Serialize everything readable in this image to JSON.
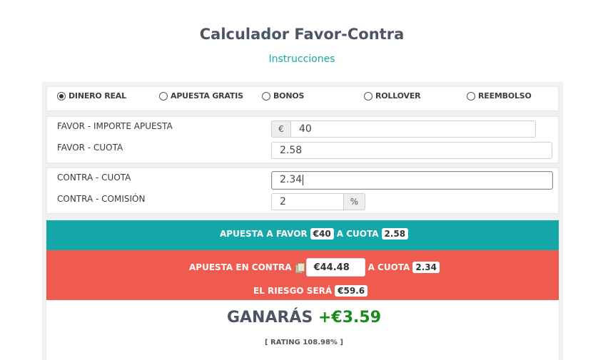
{
  "header": {
    "title": "Calculador Favor-Contra",
    "instructions_link": "Instrucciones"
  },
  "modes": [
    {
      "label": "DINERO REAL",
      "checked": true
    },
    {
      "label": "APUESTA GRATIS",
      "checked": false
    },
    {
      "label": "BONOS",
      "checked": false
    },
    {
      "label": "ROLLOVER",
      "checked": false
    },
    {
      "label": "REEMBOLSO",
      "checked": false
    }
  ],
  "favor": {
    "stake_label": "FAVOR - IMPORTE APUESTA",
    "currency_symbol": "€",
    "stake_value": "40",
    "odds_label": "FAVOR - CUOTA",
    "odds_value": "2.58"
  },
  "contra": {
    "odds_label": "CONTRA - CUOTA",
    "odds_value": "2.34",
    "commission_label": "CONTRA - COMISIÓN",
    "commission_value": "2",
    "percent_symbol": "%"
  },
  "results": {
    "favor_prefix": "APUESTA A FAVOR",
    "favor_stake": "€40",
    "favor_odds_prefix": "A CUOTA",
    "favor_odds": "2.58",
    "contra_prefix": "APUESTA EN CONTRA",
    "contra_stake": "€44.48",
    "contra_odds_prefix": "A CUOTA",
    "contra_odds": "2.34",
    "risk_prefix": "EL RIESGO SERÁ",
    "risk_value": "€59.6",
    "win_prefix": "GANARÁS",
    "win_value": "+€3.59",
    "rating": "[ RATING 108.98% ]"
  },
  "colors": {
    "favor_band": "#15a8a8",
    "contra_band": "#ef5b4f",
    "win_amount": "#1a8a1a",
    "link": "#1aa9a4"
  }
}
